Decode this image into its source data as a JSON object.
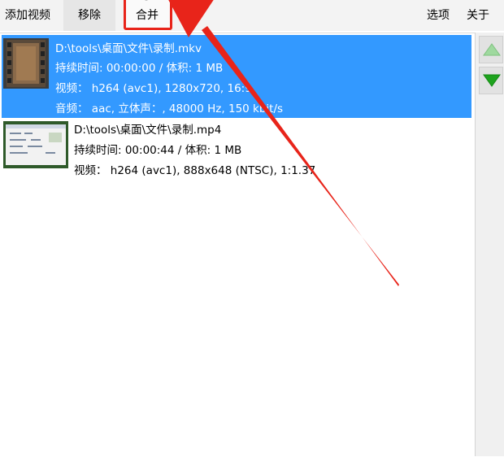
{
  "toolbar": {
    "add_video": "添加视频",
    "remove": "移除",
    "merge": "合并",
    "options": "选项",
    "about": "关于"
  },
  "files": [
    {
      "path": "D:\\tools\\桌面\\文件\\录制.mkv",
      "duration_size": "持续时间: 00:00:00 / 体积: 1 MB",
      "video": "视频： h264 (avc1), 1280x720, 16:9",
      "audio": "音频： aac, 立体声：, 48000 Hz, 150 kbit/s",
      "selected": true
    },
    {
      "path": "D:\\tools\\桌面\\文件\\录制.mp4",
      "duration_size": "持续时间: 00:00:44 / 体积: 1 MB",
      "video": "视频： h264 (avc1), 888x648 (NTSC), 1:1.37",
      "selected": false
    }
  ],
  "icons": {
    "move_up": "triangle-up-icon",
    "move_down": "triangle-down-icon",
    "film": "film-thumbnail-icon"
  },
  "colors": {
    "selection": "#3399ff",
    "annotation": "#e8241a",
    "up_arrow": "#9fd99f",
    "down_arrow": "#1ea31e"
  }
}
